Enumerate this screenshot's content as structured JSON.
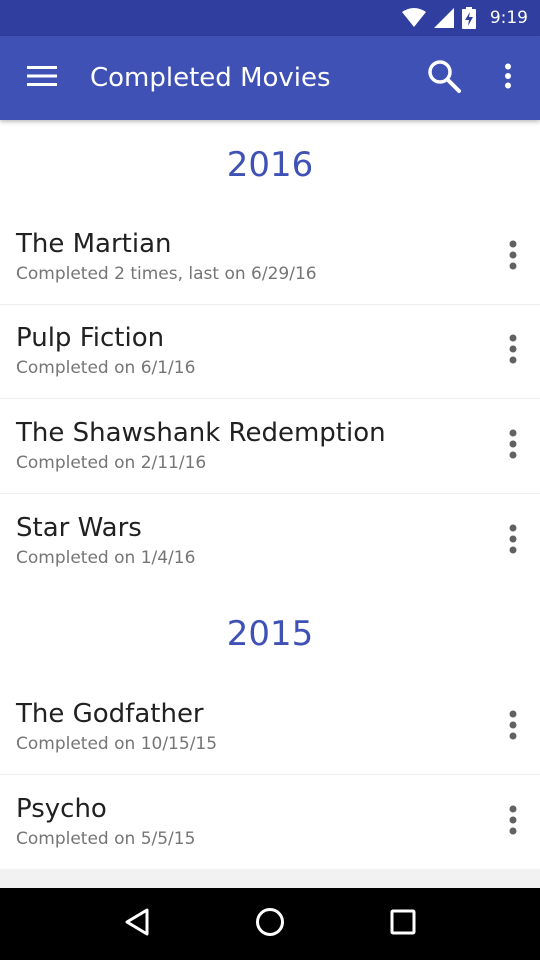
{
  "status_bar": {
    "time": "9:19",
    "icons": [
      "wifi-icon",
      "cell-signal-icon",
      "battery-charging-icon"
    ]
  },
  "app_bar": {
    "title": "Completed Movies",
    "icons": [
      "menu-icon",
      "search-icon",
      "more-vert-icon"
    ],
    "color": "#3f51b5",
    "status_color": "#303f9f"
  },
  "sections": [
    {
      "year": "2016",
      "movies": [
        {
          "title": "The Martian",
          "subtitle": "Completed 2 times, last on 6/29/16"
        },
        {
          "title": "Pulp Fiction",
          "subtitle": "Completed on 6/1/16"
        },
        {
          "title": "The Shawshank Redemption",
          "subtitle": "Completed on 2/11/16"
        },
        {
          "title": "Star Wars",
          "subtitle": "Completed on 1/4/16"
        }
      ]
    },
    {
      "year": "2015",
      "movies": [
        {
          "title": "The Godfather",
          "subtitle": "Completed on 10/15/15"
        },
        {
          "title": "Psycho",
          "subtitle": "Completed on 5/5/15"
        }
      ]
    }
  ],
  "nav_bar": {
    "icons": [
      "back-icon",
      "home-icon",
      "recents-icon"
    ]
  }
}
